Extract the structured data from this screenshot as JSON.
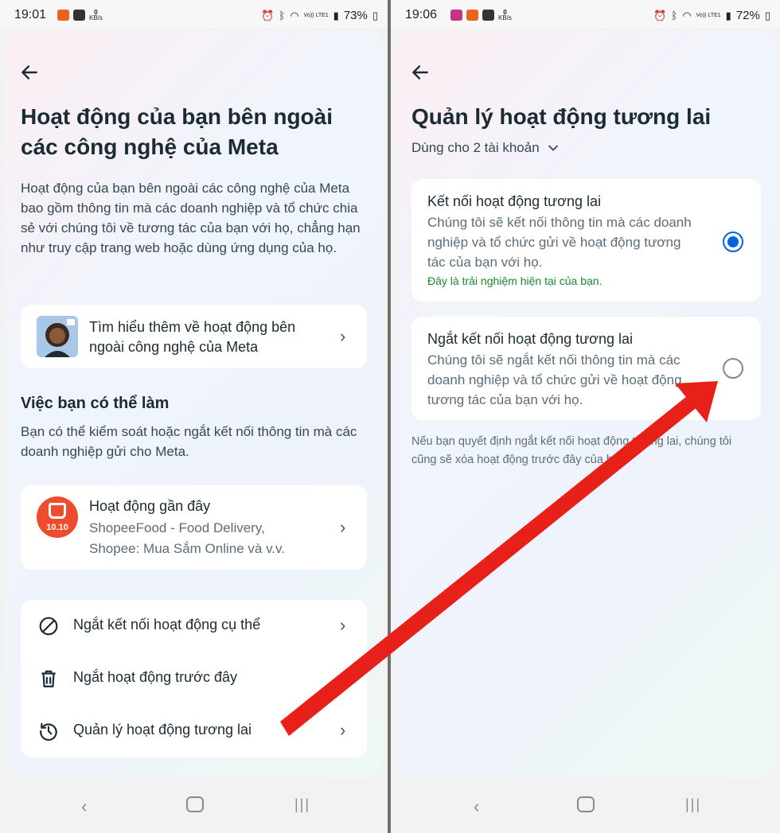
{
  "left": {
    "status": {
      "time": "19:01",
      "speed": "0",
      "speed_unit": "KB/s",
      "battery": "73%",
      "volte": "Vo)) LTE1"
    },
    "title": "Hoạt động của bạn bên ngoài các công nghệ của Meta",
    "description": "Hoạt động của bạn bên ngoài các công nghệ của Meta bao gồm thông tin mà các doanh nghiệp và tổ chức chia sẻ với chúng tôi về tương tác của bạn với họ, chẳng hạn như truy cập trang web hoặc dùng ứng dụng của họ.",
    "learn_more": "Tìm hiểu thêm về hoạt động bên ngoài công nghệ của Meta",
    "section_title": "Việc bạn có thể làm",
    "section_desc": "Bạn có thể kiểm soát hoặc ngắt kết nối thông tin mà các doanh nghiệp gửi cho Meta.",
    "recent": {
      "title": "Hoạt động gần đây",
      "subtitle": "ShopeeFood - Food Delivery, Shopee: Mua Sắm Online và v.v.",
      "app_badge": "10.10"
    },
    "actions": [
      {
        "label": "Ngắt kết nối hoạt động cụ thể",
        "icon": "disconnect-icon"
      },
      {
        "label": "Ngắt hoạt động trước đây",
        "icon": "trash-icon"
      },
      {
        "label": "Quản lý hoạt động tương lai",
        "icon": "history-clock-icon"
      }
    ]
  },
  "right": {
    "status": {
      "time": "19:06",
      "speed": "0",
      "speed_unit": "KB/s",
      "battery": "72%",
      "volte": "Vo)) LTE1"
    },
    "title": "Quản lý hoạt động tương lai",
    "account_selector": "Dùng cho 2 tài khoản",
    "options": [
      {
        "title": "Kết nối hoạt động tương lai",
        "description": "Chúng tôi sẽ kết nối thông tin mà các doanh nghiệp và tổ chức gửi về hoạt động tương tác của bạn với họ.",
        "status": "Đây là trải nghiệm hiện tại của bạn.",
        "selected": true
      },
      {
        "title": "Ngắt kết nối hoạt động tương lai",
        "description": "Chúng tôi sẽ ngắt kết nối thông tin mà các doanh nghiệp và tổ chức gửi về hoạt động tương tác của bạn với họ.",
        "selected": false
      }
    ],
    "footnote": "Nếu bạn quyết định ngắt kết nối hoạt động tương lai, chúng tôi cũng sẽ xóa hoạt động trước đây của bạn."
  },
  "colors": {
    "accent": "#0064e0",
    "annotation_arrow": "#e8201a",
    "status_green": "#168a2e"
  }
}
